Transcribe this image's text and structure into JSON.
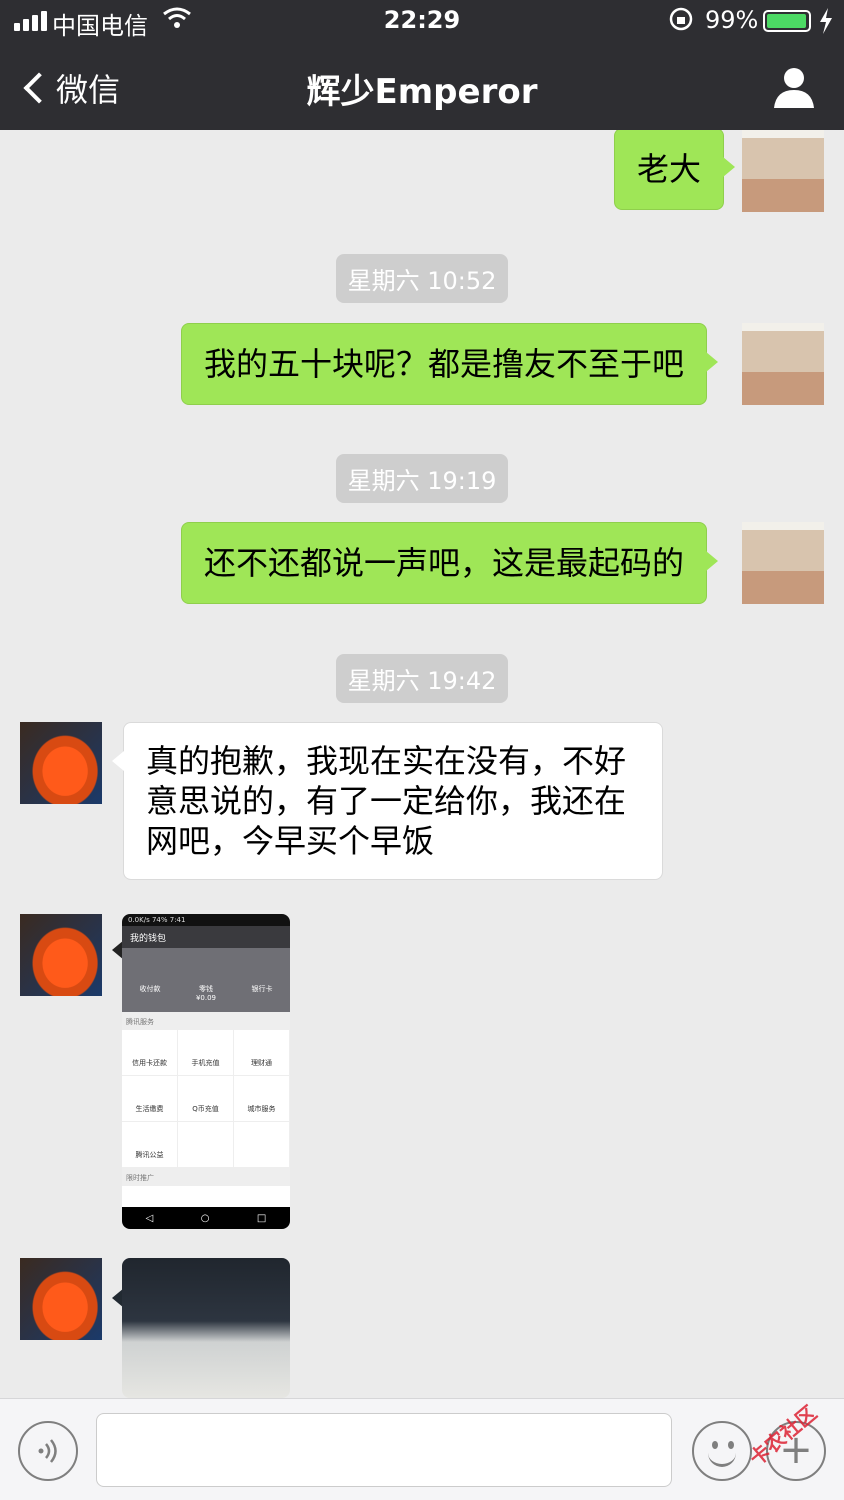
{
  "status_bar": {
    "carrier": "中国电信",
    "time": "22:29",
    "battery_percent": "99%",
    "battery_level": 0.99
  },
  "nav": {
    "back_label": "微信",
    "title": "辉少Emperor",
    "profile_icon": "person-icon"
  },
  "messages": {
    "m1": "老大",
    "ts1": "星期六 10:52",
    "m2": "我的五十块呢？都是撸友不至于吧",
    "ts2": "星期六 19:19",
    "m3": "还不还都说一声吧，这是最起码的",
    "ts3": "星期六 19:42",
    "m4": "真的抱歉，我现在实在没有，不好意思说的，有了一定给你，我还在网吧，今早买个早饭"
  },
  "wallet_screenshot": {
    "status": "0.0K/s 74% 7:41",
    "title": "我的钱包",
    "top_items": [
      "收付款",
      "零钱",
      "银行卡"
    ],
    "balance": "¥0.09",
    "section1": "腾讯服务",
    "grid": [
      "信用卡还款",
      "手机充值",
      "理财通",
      "生活缴费",
      "Q币充值",
      "城市服务",
      "腾讯公益"
    ],
    "section2": "限时推广"
  },
  "input_bar": {
    "voice_icon": "voice-icon",
    "emoji_icon": "emoji-icon",
    "plus_icon": "plus-icon",
    "watermark": "卡农社区"
  }
}
